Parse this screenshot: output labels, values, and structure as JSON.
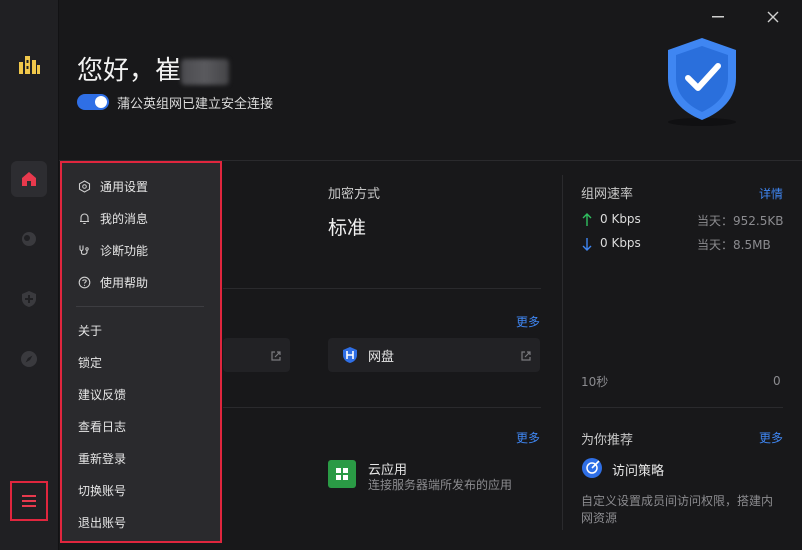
{
  "header": {
    "greeting": "您好，崔",
    "status_text": "蒲公英组网已建立安全连接"
  },
  "encryption": {
    "label": "加密方式",
    "value": "标准"
  },
  "speed": {
    "title": "组网速率",
    "details_link": "详情",
    "upload": "0 Kbps",
    "upload_today": "当天：952.5KB",
    "download": "0 Kbps",
    "download_today": "当天：8.5MB",
    "axis_left": "10秒",
    "axis_right": "0"
  },
  "apps": {
    "more_link_1": "更多",
    "netdisk_label": "网盘",
    "more_link_2": "更多",
    "cloud_app_title": "云应用",
    "cloud_app_desc": "连接服务器端所发布的应用"
  },
  "recommend": {
    "title": "为你推荐",
    "more_link": "更多",
    "item_title": "访问策略",
    "item_desc": "自定义设置成员间访问权限，搭建内网资源"
  },
  "menu": {
    "general_settings": "通用设置",
    "my_messages": "我的消息",
    "diagnose": "诊断功能",
    "help": "使用帮助",
    "about": "关于",
    "lock": "锁定",
    "feedback": "建议反馈",
    "view_logs": "查看日志",
    "relogin": "重新登录",
    "switch_account": "切换账号",
    "logout": "退出账号"
  },
  "colors": {
    "accent": "#2f6fe6",
    "highlight": "#e0263e",
    "home_active": "#e8394d",
    "upload_arrow": "#2fbf5f",
    "download_arrow": "#3f86f2"
  }
}
